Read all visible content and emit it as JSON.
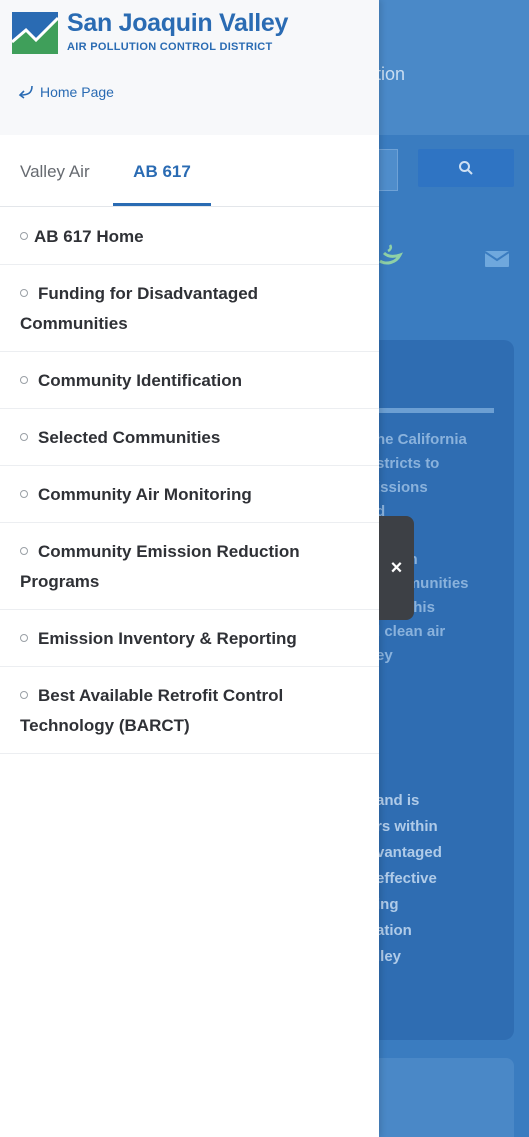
{
  "background": {
    "title_fragment": "tion",
    "text_lines_1": [
      "he California",
      "stricts to",
      "issions",
      "d",
      "on",
      "Given",
      "communities",
      "lley, this",
      "l clean air",
      "ey"
    ],
    "text_lines_2": [
      "and is",
      "rs within",
      "vantaged",
      "effective",
      "ing",
      "ation",
      "lley"
    ]
  },
  "logo": {
    "name": "San Joaquin Valley",
    "subtitle": "AIR POLLUTION CONTROL DISTRICT"
  },
  "home_link": "Home Page",
  "tabs": [
    {
      "label": "Valley Air",
      "active": false
    },
    {
      "label": "AB 617",
      "active": true
    }
  ],
  "menu": [
    "AB 617 Home",
    "Funding for Disadvantaged Communities",
    "Community Identification",
    "Selected Communities",
    "Community Air Monitoring",
    "Community Emission Reduction Programs",
    "Emission Inventory & Reporting",
    "Best Available Retrofit Control Technology (BARCT)"
  ],
  "close_label": "×",
  "colors": {
    "brand_blue": "#2a6bb3",
    "overlay_blue": "#3a7cc0",
    "close_tab": "#3d4045"
  }
}
